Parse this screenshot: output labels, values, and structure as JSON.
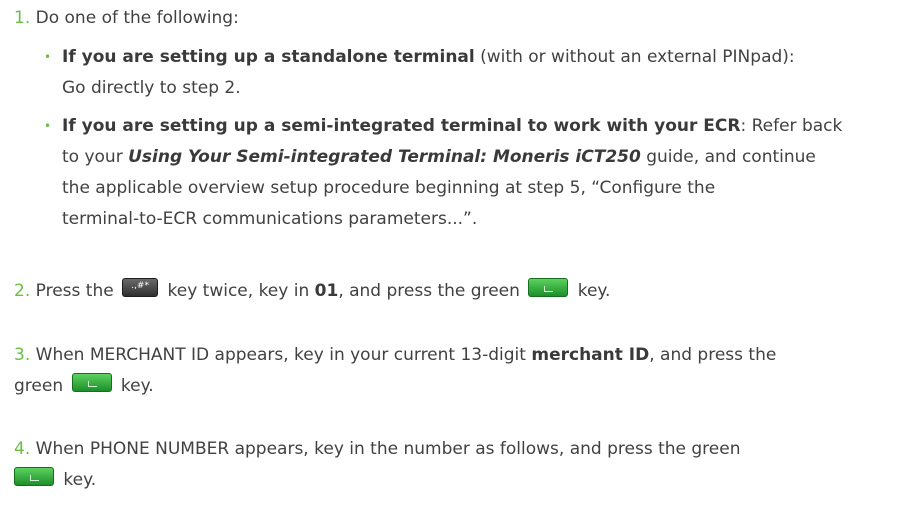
{
  "steps": [
    {
      "num": "1.",
      "text": "Do one of the following:",
      "bullets": [
        {
          "bold": "If you are setting up a standalone terminal",
          "line1": " (with or without an external PINpad):",
          "line2": "Go directly to step 2."
        },
        {
          "bold": "If you are setting up a semi-integrated terminal to work with your ECR",
          "line1": ": Refer back",
          "line2_pre": "to your ",
          "line2_italic": "Using Your Semi-integrated Terminal: Moneris iCT250",
          "line2_post": " guide, and continue",
          "line3": "the applicable overview setup procedure beginning at step 5, “Configure the",
          "line4": "terminal-to-ECR communications parameters...”."
        }
      ]
    },
    {
      "num": "2.",
      "pre": "Press the",
      "mid1": "key twice, key in ",
      "bold": "01",
      "mid2": ", and press the green",
      "post": "key."
    },
    {
      "num": "3.",
      "line1_pre": "When MERCHANT ID appears, key in your current 13-digit ",
      "bold": "merchant ID",
      "line1_post": ", and press the",
      "line2_pre": "green",
      "line2_post": "key."
    },
    {
      "num": "4.",
      "line1": "When PHONE NUMBER appears, key in the number as follows, and press the green",
      "line2_post": "key."
    }
  ],
  "keys": {
    "function_key": ".,#*",
    "function_key_icon": "dot-hash-star-key-icon",
    "ok_key_icon": "green-ok-key-icon",
    "ok_key_color": "#2fae3c"
  },
  "colors": {
    "step_number": "#6bbf45",
    "text": "#414141"
  }
}
